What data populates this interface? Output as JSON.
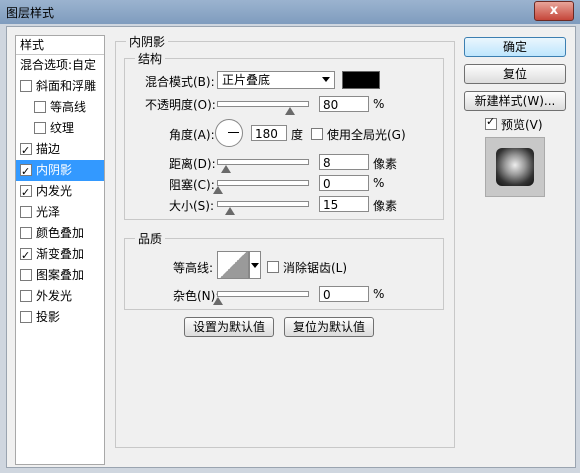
{
  "window": {
    "title": "图层样式",
    "close_glyph": "x"
  },
  "sidebar": {
    "header": "样式",
    "items": [
      {
        "label": "混合选项:自定",
        "checkbox": false,
        "checked": false,
        "sub": false
      },
      {
        "label": "斜面和浮雕",
        "checkbox": true,
        "checked": false,
        "sub": false
      },
      {
        "label": "等高线",
        "checkbox": true,
        "checked": false,
        "sub": true
      },
      {
        "label": "纹理",
        "checkbox": true,
        "checked": false,
        "sub": true
      },
      {
        "label": "描边",
        "checkbox": true,
        "checked": true,
        "sub": false
      },
      {
        "label": "内阴影",
        "checkbox": true,
        "checked": true,
        "sub": false,
        "selected": true
      },
      {
        "label": "内发光",
        "checkbox": true,
        "checked": true,
        "sub": false
      },
      {
        "label": "光泽",
        "checkbox": true,
        "checked": false,
        "sub": false
      },
      {
        "label": "颜色叠加",
        "checkbox": true,
        "checked": false,
        "sub": false
      },
      {
        "label": "渐变叠加",
        "checkbox": true,
        "checked": true,
        "sub": false
      },
      {
        "label": "图案叠加",
        "checkbox": true,
        "checked": false,
        "sub": false
      },
      {
        "label": "外发光",
        "checkbox": true,
        "checked": false,
        "sub": false
      },
      {
        "label": "投影",
        "checkbox": true,
        "checked": false,
        "sub": false
      }
    ]
  },
  "inner_shadow": {
    "title": "内阴影",
    "structure": {
      "title": "结构",
      "blend_mode_label": "混合模式(B):",
      "blend_mode_value": "正片叠底",
      "blend_color": "#000000",
      "opacity_label": "不透明度(O):",
      "opacity_value": "80",
      "opacity_unit": "%",
      "angle_label": "角度(A):",
      "angle_value": "180",
      "angle_unit": "度",
      "global_light_label": "使用全局光(G)",
      "distance_label": "距离(D):",
      "distance_value": "8",
      "distance_unit": "像素",
      "choke_label": "阻塞(C):",
      "choke_value": "0",
      "choke_unit": "%",
      "size_label": "大小(S):",
      "size_value": "15",
      "size_unit": "像素"
    },
    "quality": {
      "title": "品质",
      "contour_label": "等高线:",
      "antialias_label": "消除锯齿(L)",
      "noise_label": "杂色(N):",
      "noise_value": "0",
      "noise_unit": "%"
    },
    "set_default": "设置为默认值",
    "reset_default": "复位为默认值"
  },
  "buttons": {
    "ok": "确定",
    "reset": "复位",
    "new_style": "新建样式(W)...",
    "preview_label": "预览(V)"
  }
}
